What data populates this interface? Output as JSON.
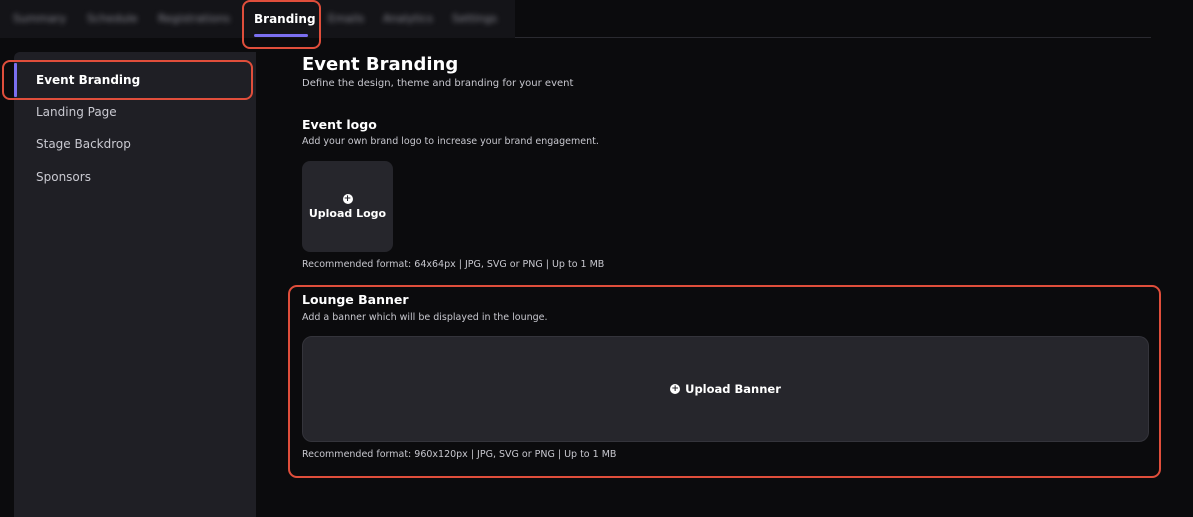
{
  "tabs": {
    "items": [
      "Summary",
      "Schedule",
      "Registrations",
      "Emails",
      "Analytics",
      "Settings"
    ],
    "active": "Branding"
  },
  "sidebar": {
    "items": [
      {
        "label": "Event Branding",
        "active": true
      },
      {
        "label": "Landing Page",
        "active": false
      },
      {
        "label": "Stage Backdrop",
        "active": false
      },
      {
        "label": "Sponsors",
        "active": false
      }
    ]
  },
  "main": {
    "title": "Event Branding",
    "subtitle": "Define the design, theme and branding for your event",
    "logo": {
      "title": "Event logo",
      "description": "Add your own brand logo to increase your brand engagement.",
      "upload_label": "Upload Logo",
      "format_note": "Recommended format: 64x64px | JPG, SVG or PNG | Up to 1 MB"
    },
    "banner": {
      "title": "Lounge Banner",
      "description": "Add a banner which will be displayed in the lounge.",
      "upload_label": "Upload Banner",
      "format_note": "Recommended format: 960x120px | JPG, SVG or PNG | Up to 1 MB"
    }
  },
  "colors": {
    "accent": "#7b6ff0",
    "highlight": "#e04e3b",
    "background": "#0b0b0d",
    "sidebar": "#1f1f25",
    "card": "#26262c"
  },
  "icons": {
    "upload": "plus-circle-icon"
  }
}
